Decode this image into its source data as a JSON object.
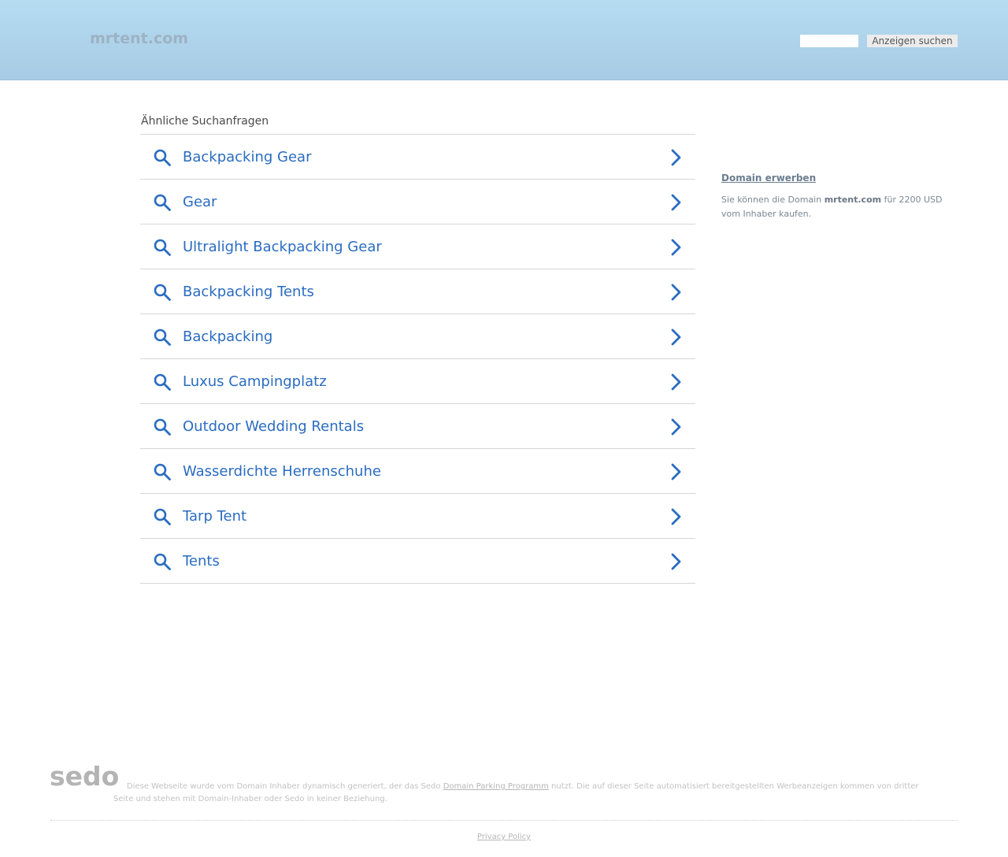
{
  "header": {
    "logo_text": "mrtent.com",
    "search_input_value": "",
    "search_button_label": "Anzeigen suchen"
  },
  "related": {
    "title": "Ähnliche Suchanfragen",
    "items": [
      {
        "label": "Backpacking Gear"
      },
      {
        "label": "Gear"
      },
      {
        "label": "Ultralight Backpacking Gear"
      },
      {
        "label": "Backpacking Tents"
      },
      {
        "label": "Backpacking"
      },
      {
        "label": "Luxus Campingplatz"
      },
      {
        "label": "Outdoor Wedding Rentals"
      },
      {
        "label": "Wasserdichte Herrenschuhe"
      },
      {
        "label": "Tarp Tent"
      },
      {
        "label": "Tents"
      }
    ]
  },
  "sidebar": {
    "domain_link": "Domain erwerben",
    "text_before": "Sie können die Domain ",
    "domain_name": "mrtent.com",
    "text_after": " für 2200 USD vom Inhaber kaufen."
  },
  "footer": {
    "sedo_logo": "sedo",
    "disclaimer_before": "Diese Webseite wurde vom Domain Inhaber dynamisch generiert, der das Sedo ",
    "disclaimer_link": "Domain Parking Programm",
    "disclaimer_after": " nutzt. Die auf dieser Seite automatisiert bereitgestellten Werbeanzeigen kommen von dritter Seite und stehen mit Domain-Inhaber oder Sedo in keiner Beziehung.",
    "privacy_link": "Privacy Policy"
  },
  "colors": {
    "accent_link": "#2a6cc0",
    "header_top": "#b5dcf1",
    "header_bottom": "#a7cbe4"
  },
  "icons": {
    "item_leading": "search-icon",
    "item_trailing": "chevron-right-icon"
  }
}
